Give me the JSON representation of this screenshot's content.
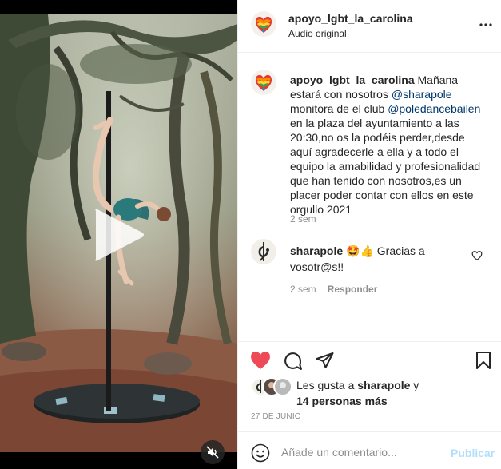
{
  "post": {
    "account": "apoyo_lgbt_la_carolina",
    "audio": "Audio original",
    "caption_user": "apoyo_lgbt_la_carolina",
    "caption_parts": {
      "p1": " Mañana estará con nosotros ",
      "mention1": "@sharapole",
      "p2": " monitora de el club ",
      "mention2": "@poledancebailen",
      "p3": " en la plaza del ayuntamiento a las 20:30,no os la podéis perder,desde aquí agradecerle a ella y a todo el equipo la amabilidad y profesionalidad que han tenido con nosotros,es un placer poder contar con ellos en este orgullo 2021"
    },
    "caption_time": "2 sem"
  },
  "comment": {
    "user": "sharapole",
    "text": " 🤩👍 Gracias a vosotr@s!!",
    "time": "2 sem",
    "reply_label": "Responder"
  },
  "likes": {
    "prefix": "Les gusta a ",
    "user": "sharapole",
    "mid": " y",
    "others": "14 personas más"
  },
  "date": "27 DE JUNIO",
  "comment_box": {
    "placeholder": "Añade un comentario...",
    "publish_label": "Publicar"
  },
  "icons": {
    "like": "heart-filled-icon",
    "comment": "comment-bubble-icon",
    "share": "paper-plane-icon",
    "save": "bookmark-icon",
    "more": "more-options-icon",
    "mute": "muted-speaker-icon",
    "play": "play-icon",
    "emoji": "smiley-icon"
  },
  "colors": {
    "like_red": "#ed4956",
    "mention_blue": "#00376b",
    "muted_gray": "#8e8e8e",
    "publish_disabled": "#b2dffc"
  }
}
